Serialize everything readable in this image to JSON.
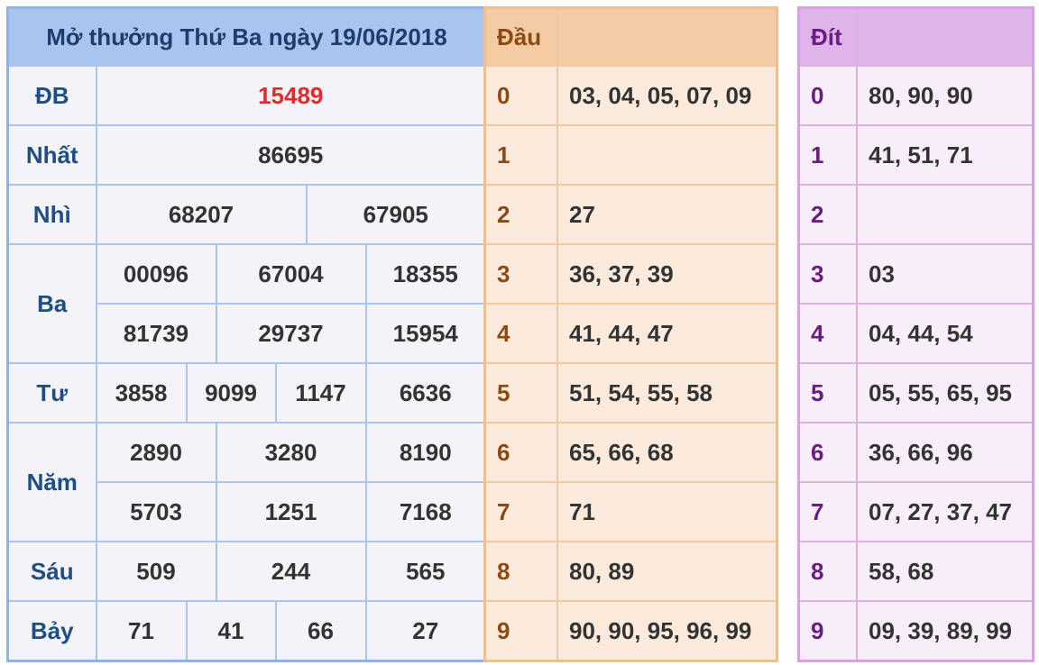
{
  "results": {
    "title": "Mở thưởng Thứ Ba ngày 19/06/2018",
    "db": {
      "label": "ĐB",
      "value": "15489"
    },
    "nhat": {
      "label": "Nhất",
      "value": "86695"
    },
    "nhi": {
      "label": "Nhì",
      "values": [
        "68207",
        "67905"
      ]
    },
    "ba": {
      "label": "Ba",
      "values": [
        "00096",
        "67004",
        "18355",
        "81739",
        "29737",
        "15954"
      ]
    },
    "tu": {
      "label": "Tư",
      "values": [
        "3858",
        "9099",
        "1147",
        "6636"
      ]
    },
    "nam": {
      "label": "Năm",
      "values": [
        "2890",
        "3280",
        "8190",
        "5703",
        "1251",
        "7168"
      ]
    },
    "sau": {
      "label": "Sáu",
      "values": [
        "509",
        "244",
        "565"
      ]
    },
    "bay": {
      "label": "Bảy",
      "values": [
        "71",
        "41",
        "66",
        "27"
      ]
    }
  },
  "dau": {
    "header": "Đầu",
    "rows": [
      {
        "num": "0",
        "values": "03, 04, 05, 07, 09"
      },
      {
        "num": "1",
        "values": ""
      },
      {
        "num": "2",
        "values": "27"
      },
      {
        "num": "3",
        "values": "36, 37, 39"
      },
      {
        "num": "4",
        "values": "41, 44, 47"
      },
      {
        "num": "5",
        "values": "51, 54, 55, 58"
      },
      {
        "num": "6",
        "values": "65, 66, 68"
      },
      {
        "num": "7",
        "values": "71"
      },
      {
        "num": "8",
        "values": "80, 89"
      },
      {
        "num": "9",
        "values": "90, 90, 95, 96, 99"
      }
    ]
  },
  "dit": {
    "header": "Đít",
    "rows": [
      {
        "num": "0",
        "values": "80, 90, 90"
      },
      {
        "num": "1",
        "values": "41, 51, 71"
      },
      {
        "num": "2",
        "values": ""
      },
      {
        "num": "3",
        "values": "03"
      },
      {
        "num": "4",
        "values": "04, 44, 54"
      },
      {
        "num": "5",
        "values": "05, 55, 65, 95"
      },
      {
        "num": "6",
        "values": "36, 66, 96"
      },
      {
        "num": "7",
        "values": "07, 27, 37, 47"
      },
      {
        "num": "8",
        "values": "58, 68"
      },
      {
        "num": "9",
        "values": "09, 39, 89, 99"
      }
    ]
  },
  "colors": {
    "special_prize": "#e02b2b",
    "prize_label": "#1f4e84",
    "dau_number": "#8a4a12",
    "dit_number": "#6a1c85"
  }
}
